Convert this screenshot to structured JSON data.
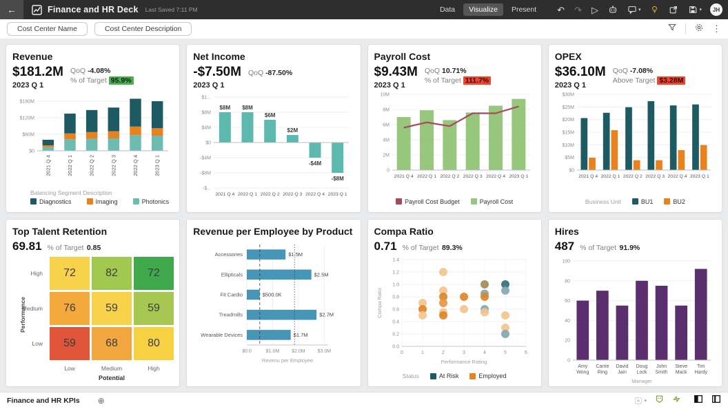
{
  "header": {
    "title": "Finance and HR Deck",
    "last_saved": "Last Saved 7:11 PM",
    "tabs": [
      "Data",
      "Visualize",
      "Present"
    ],
    "active_tab": "Visualize",
    "avatar": "JH"
  },
  "icons": {
    "back": "←",
    "undo": "↶",
    "redo": "↷",
    "play": "▷",
    "caret": "▾",
    "kebab": "⋮",
    "add_page": "⊕"
  },
  "toolbar": {
    "filter1": "Cost Center Name",
    "filter2": "Cost Center Description"
  },
  "footer": {
    "page_tab": "Finance and HR KPIs"
  },
  "colors": {
    "badge_green": "#4cae4f",
    "badge_red": "#f4432c",
    "topbar": "#2e2e2e",
    "bulb_gold": "#d9a43a"
  },
  "cards": [
    {
      "title": "Revenue",
      "value": "$181.2M",
      "qoq_label": "QoQ",
      "qoq_value": "-4.08%",
      "target_label": "% of Target",
      "target_value": "95.9%",
      "period": "2023 Q 1"
    },
    {
      "title": "Net Income",
      "value": "-$7.50M",
      "qoq_label": "QoQ",
      "qoq_value": "-87.50%",
      "period": "2023 Q 1"
    },
    {
      "title": "Payroll Cost",
      "value": "$9.43M",
      "qoq_label": "QoQ",
      "qoq_value": "10.71%",
      "target_label": "% of Target",
      "target_value": "111.7%",
      "period": "2023 Q 1"
    },
    {
      "title": "OPEX",
      "value": "$36.10M",
      "qoq_label": "QoQ",
      "qoq_value": "-7.08%",
      "target_label": "Above Target",
      "target_value": "$3.28M",
      "period": "2023 Q 1"
    },
    {
      "title": "Top Talent Retention",
      "value": "69.81",
      "target_label": "% of Target",
      "target_value": "0.85"
    },
    {
      "title": "Revenue per Employee by Product"
    },
    {
      "title": "Compa Ratio",
      "value": "0.71",
      "target_label": "% of Target",
      "target_value": "89.3%"
    },
    {
      "title": "Hires",
      "value": "487",
      "target_label": "% of Target",
      "target_value": "91.9%"
    }
  ],
  "chart_data": [
    {
      "type": "bar",
      "subtype": "stacked",
      "title": "Revenue",
      "categories": [
        "2021 Q 4",
        "2022 Q 1",
        "2022 Q 2",
        "2022 Q 3",
        "2022 Q 4",
        "2023 Q 1"
      ],
      "series": [
        {
          "name": "Photonics",
          "color": "#6cbcb2",
          "values": [
            13,
            42,
            44,
            45,
            57,
            55
          ]
        },
        {
          "name": "Imaging",
          "color": "#e8821e",
          "values": [
            7,
            21,
            24,
            26,
            31,
            27
          ]
        },
        {
          "name": "Diagnostics",
          "color": "#1d5a63",
          "values": [
            20,
            72,
            80,
            86,
            101,
            98
          ]
        }
      ],
      "yticks": [
        {
          "v": 0,
          "label": "$0"
        },
        {
          "v": 60,
          "label": "$60M"
        },
        {
          "v": 120,
          "label": "$120M"
        },
        {
          "v": 180,
          "label": "$180M"
        }
      ],
      "ylim": [
        0,
        200
      ],
      "legend_title": "Balancing Segment Description",
      "legend": [
        {
          "label": "Diagnostics",
          "color": "#1d5a63"
        },
        {
          "label": "Imaging",
          "color": "#e8821e"
        },
        {
          "label": "Photonics",
          "color": "#6cbcb2"
        }
      ]
    },
    {
      "type": "bar",
      "title": "Net Income",
      "categories": [
        "2021 Q 4",
        "2022 Q 1",
        "2022 Q 2",
        "2022 Q 3",
        "2022 Q 4",
        "2023 Q 1"
      ],
      "values": [
        8,
        8,
        6,
        2,
        -4,
        -8
      ],
      "labels": [
        "$8M",
        "$8M",
        "$6M",
        "$2M",
        "-$4M",
        "-$8M"
      ],
      "color": "#5bb9b0",
      "yticks": [
        {
          "v": 12,
          "label": "$1..."
        },
        {
          "v": 8,
          "label": "$8M"
        },
        {
          "v": 4,
          "label": "$4M"
        },
        {
          "v": 0,
          "label": "$0"
        },
        {
          "v": -4,
          "label": "-$4M"
        },
        {
          "v": -8,
          "label": "-$8M"
        },
        {
          "v": -12,
          "label": "-$..."
        }
      ],
      "ylim": [
        -12,
        12
      ]
    },
    {
      "type": "bar",
      "subtype": "line_overlay",
      "title": "Payroll Cost",
      "categories": [
        "2021 Q 4",
        "2022 Q 1",
        "2022 Q 2",
        "2022 Q 3",
        "2022 Q 4",
        "2023 Q 1"
      ],
      "bars": {
        "name": "Payroll Cost",
        "color": "#97c77d",
        "values": [
          7.0,
          7.9,
          6.6,
          7.6,
          8.5,
          9.4
        ]
      },
      "line": {
        "name": "Payroll Cost Budget",
        "color": "#a34a5c",
        "values": [
          5.6,
          6.3,
          5.8,
          7.5,
          7.5,
          8.4
        ]
      },
      "yticks": [
        {
          "v": 0,
          "label": "0"
        },
        {
          "v": 2,
          "label": "2M"
        },
        {
          "v": 4,
          "label": "4M"
        },
        {
          "v": 6,
          "label": "6M"
        },
        {
          "v": 8,
          "label": "8M"
        },
        {
          "v": 10,
          "label": "10M"
        }
      ],
      "ylim": [
        0,
        10
      ],
      "legend": [
        {
          "label": "Payroll Cost Budget",
          "color": "#a34a5c"
        },
        {
          "label": "Payroll Cost",
          "color": "#97c77d"
        }
      ]
    },
    {
      "type": "bar",
      "subtype": "grouped",
      "title": "OPEX",
      "categories": [
        "2021 Q 4",
        "2022 Q 1",
        "2022 Q 2",
        "2022 Q 3",
        "2022 Q 4",
        "2023 Q 1"
      ],
      "series": [
        {
          "name": "BU1",
          "color": "#1d5a63",
          "values": [
            20.6,
            22.7,
            24.9,
            27.3,
            25.6,
            26.0
          ]
        },
        {
          "name": "BU2",
          "color": "#e8821e",
          "values": [
            4.9,
            15.8,
            3.9,
            3.9,
            7.9,
            9.9
          ]
        }
      ],
      "yticks": [
        {
          "v": 0,
          "label": "$0"
        },
        {
          "v": 5,
          "label": "$5M"
        },
        {
          "v": 10,
          "label": "$10M"
        },
        {
          "v": 15,
          "label": "$15M"
        },
        {
          "v": 20,
          "label": "$20M"
        },
        {
          "v": 25,
          "label": "$25M"
        },
        {
          "v": 30,
          "label": "$30M"
        }
      ],
      "ylim": [
        0,
        30
      ],
      "legend_title": "Business Unit",
      "legend": [
        {
          "label": "BU1",
          "color": "#1d5a63"
        },
        {
          "label": "BU2",
          "color": "#e8821e"
        }
      ]
    },
    {
      "type": "heatmap",
      "title": "Top Talent Retention",
      "row_labels": [
        "High",
        "Medium",
        "Low"
      ],
      "col_labels": [
        "Low",
        "Medium",
        "High"
      ],
      "cells": [
        [
          {
            "value": 72,
            "color": "#f8d24a"
          },
          {
            "value": 82,
            "color": "#a2c94f"
          },
          {
            "value": 72,
            "color": "#3fa94c"
          }
        ],
        [
          {
            "value": 76,
            "color": "#f3a93c"
          },
          {
            "value": 59,
            "color": "#f8d24a"
          },
          {
            "value": 59,
            "color": "#a6c853"
          }
        ],
        [
          {
            "value": 59,
            "color": "#e0553a"
          },
          {
            "value": 68,
            "color": "#f1a73e"
          },
          {
            "value": 80,
            "color": "#f6d243"
          }
        ]
      ],
      "ylabel": "Performance",
      "xlabel": "Potential"
    },
    {
      "type": "bar",
      "subtype": "horizontal",
      "title": "Revenue per Employee by Product",
      "categories": [
        "Accessories",
        "Ellipticals",
        "Fit Cardio",
        "Treadmills",
        "Wearable Devices"
      ],
      "values": [
        1.5,
        2.5,
        0.5,
        2.7,
        1.7
      ],
      "labels": [
        "$1.5M",
        "$2.5M",
        "$500.0K",
        "$2.7M",
        "$1.7M"
      ],
      "color": "#4795b7",
      "xticks": [
        {
          "v": 0,
          "label": "$0.0"
        },
        {
          "v": 1,
          "label": "$1.0M"
        },
        {
          "v": 2,
          "label": "$2.0M"
        },
        {
          "v": 3,
          "label": "$3.0M"
        }
      ],
      "xlim": [
        0,
        3.15
      ],
      "ref_lines": [
        {
          "v": 0.5,
          "style": "dashed"
        },
        {
          "v": 1.85,
          "style": "dotted"
        }
      ],
      "xlabel": "Revenu per Employee"
    },
    {
      "type": "scatter",
      "title": "Compa Ratio",
      "points": [
        {
          "x": 1,
          "y": 0.7,
          "color": "#f2c48e"
        },
        {
          "x": 1,
          "y": 0.6,
          "color": "#de8527"
        },
        {
          "x": 1,
          "y": 0.5,
          "color": "#f2c48e"
        },
        {
          "x": 2,
          "y": 1.2,
          "color": "#f2c48e"
        },
        {
          "x": 2,
          "y": 0.9,
          "color": "#f2c48e"
        },
        {
          "x": 2,
          "y": 0.8,
          "color": "#de8527"
        },
        {
          "x": 2,
          "y": 0.7,
          "color": "#e89544"
        },
        {
          "x": 2,
          "y": 0.55,
          "color": "#f2c48e"
        },
        {
          "x": 2,
          "y": 0.5,
          "color": "#de8527"
        },
        {
          "x": 3,
          "y": 0.8,
          "color": "#de8527"
        },
        {
          "x": 3,
          "y": 0.6,
          "color": "#f2c48e"
        },
        {
          "x": 4,
          "y": 1.0,
          "color": "#a38b58"
        },
        {
          "x": 4,
          "y": 0.85,
          "color": "#84a7b0"
        },
        {
          "x": 4,
          "y": 0.8,
          "color": "#de8527"
        },
        {
          "x": 4,
          "y": 0.6,
          "color": "#84a7b0"
        },
        {
          "x": 4,
          "y": 0.55,
          "color": "#f2c48e"
        },
        {
          "x": 5,
          "y": 1.0,
          "color": "#336f79"
        },
        {
          "x": 5,
          "y": 0.9,
          "color": "#84a7b0"
        },
        {
          "x": 5,
          "y": 0.5,
          "color": "#f2c48e"
        },
        {
          "x": 5,
          "y": 0.3,
          "color": "#f2c48e"
        },
        {
          "x": 5,
          "y": 0.2,
          "color": "#84a7b0"
        }
      ],
      "xticks": [
        0,
        1,
        2,
        3,
        4,
        5,
        6
      ],
      "yticks": [
        "0.0",
        "0.2",
        "0.4",
        "0.6",
        "0.8",
        "1.0",
        "1.2",
        "1.4"
      ],
      "xlim": [
        0,
        6
      ],
      "ylim": [
        0,
        1.4
      ],
      "xlabel": "Performance Rating",
      "ylabel": "Compa Ratio",
      "legend_title": "Status",
      "legend": [
        {
          "label": "At Risk",
          "color": "#1d5a63"
        },
        {
          "label": "Employed",
          "color": "#e8821e"
        }
      ]
    },
    {
      "type": "bar",
      "subtype": "two_line_labels",
      "title": "Hires",
      "categories": [
        "Amy Wong",
        "Carrie Ring",
        "David Jain",
        "Doug Lock",
        "John Smith",
        "Steve Mack",
        "Tim Hardy"
      ],
      "values": [
        60,
        70,
        55,
        80,
        75,
        55,
        92
      ],
      "color": "#5b2f6e",
      "yticks": [
        {
          "v": 0,
          "label": "0"
        },
        {
          "v": 20,
          "label": "20"
        },
        {
          "v": 40,
          "label": "40"
        },
        {
          "v": 60,
          "label": "60"
        },
        {
          "v": 80,
          "label": "80"
        },
        {
          "v": 100,
          "label": "100"
        }
      ],
      "ylim": [
        0,
        100
      ],
      "xlabel": "Manager"
    }
  ]
}
